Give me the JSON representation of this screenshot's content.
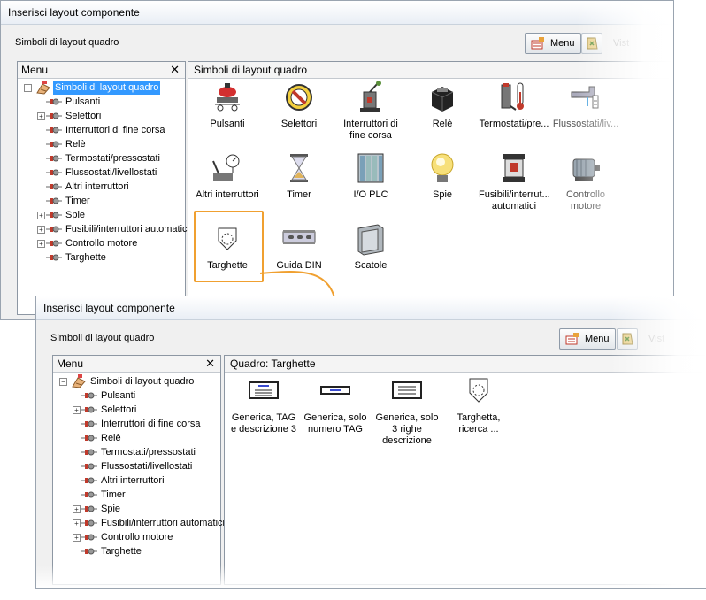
{
  "window1": {
    "title": "Inserisci layout componente",
    "toolbar_label": "Simboli di layout quadro",
    "menu_button": "Menu",
    "vista_label": "Vist",
    "left_panel_title": "Menu",
    "right_panel_title": "Simboli di layout quadro",
    "tree": {
      "root": "Simboli di layout quadro",
      "items": [
        {
          "label": "Pulsanti",
          "expandable": false
        },
        {
          "label": "Selettori",
          "expandable": true
        },
        {
          "label": "Interruttori di fine corsa",
          "expandable": false
        },
        {
          "label": "Relè",
          "expandable": false
        },
        {
          "label": "Termostati/pressostati",
          "expandable": false
        },
        {
          "label": "Flussostati/livellostati",
          "expandable": false
        },
        {
          "label": "Altri interruttori",
          "expandable": false
        },
        {
          "label": "Timer",
          "expandable": false
        },
        {
          "label": "Spie",
          "expandable": true
        },
        {
          "label": "Fusibili/interruttori automatici",
          "expandable": true
        },
        {
          "label": "Controllo motore",
          "expandable": true
        },
        {
          "label": "Targhette",
          "expandable": false
        }
      ]
    },
    "symbols": [
      {
        "caption": "Pulsanti",
        "icon": "pushbutton-icon"
      },
      {
        "caption": "Selettori",
        "icon": "selector-switch-icon"
      },
      {
        "caption": "Interruttori di fine corsa",
        "icon": "limit-switch-icon"
      },
      {
        "caption": "Relè",
        "icon": "relay-icon"
      },
      {
        "caption": "Termostati/pre...",
        "icon": "thermostat-icon"
      },
      {
        "caption": "Flussostati/liv...",
        "icon": "flow-switch-icon"
      },
      {
        "caption": "Altri interruttori",
        "icon": "other-switch-icon"
      },
      {
        "caption": "Timer",
        "icon": "hourglass-icon"
      },
      {
        "caption": "I/O PLC",
        "icon": "plc-icon"
      },
      {
        "caption": "Spie",
        "icon": "pilot-light-icon"
      },
      {
        "caption": "Fusibili/interrut... automatici",
        "icon": "fuse-icon"
      },
      {
        "caption": "Controllo motore",
        "icon": "motor-icon"
      },
      {
        "caption": "Targhette",
        "icon": "nameplate-icon"
      },
      {
        "caption": "Guida DIN",
        "icon": "din-rail-icon"
      },
      {
        "caption": "Scatole",
        "icon": "enclosure-icon"
      }
    ]
  },
  "window2": {
    "title": "Inserisci layout componente",
    "toolbar_label": "Simboli di layout quadro",
    "menu_button": "Menu",
    "vista_label": "Vist",
    "left_panel_title": "Menu",
    "right_panel_title": "Quadro: Targhette",
    "tree": {
      "root": "Simboli di layout quadro",
      "items": [
        {
          "label": "Pulsanti",
          "expandable": false
        },
        {
          "label": "Selettori",
          "expandable": true
        },
        {
          "label": "Interruttori di fine corsa",
          "expandable": false
        },
        {
          "label": "Relè",
          "expandable": false
        },
        {
          "label": "Termostati/pressostati",
          "expandable": false
        },
        {
          "label": "Flussostati/livellostati",
          "expandable": false
        },
        {
          "label": "Altri interruttori",
          "expandable": false
        },
        {
          "label": "Timer",
          "expandable": false
        },
        {
          "label": "Spie",
          "expandable": true
        },
        {
          "label": "Fusibili/interruttori automatici",
          "expandable": true
        },
        {
          "label": "Controllo motore",
          "expandable": true
        },
        {
          "label": "Targhette",
          "expandable": false
        }
      ]
    },
    "symbols": [
      {
        "caption": "Generica, TAG e descrizione 3",
        "icon": "plate-tag-desc-icon"
      },
      {
        "caption": "Generica, solo numero TAG",
        "icon": "plate-tag-only-icon"
      },
      {
        "caption": "Generica, solo 3 righe descrizione",
        "icon": "plate-3lines-icon"
      },
      {
        "caption": "Targhetta, ricerca ...",
        "icon": "plate-search-icon"
      }
    ]
  },
  "colors": {
    "selection": "#3399ff",
    "highlight": "#f0a030",
    "panel_border": "#8d97a3"
  }
}
